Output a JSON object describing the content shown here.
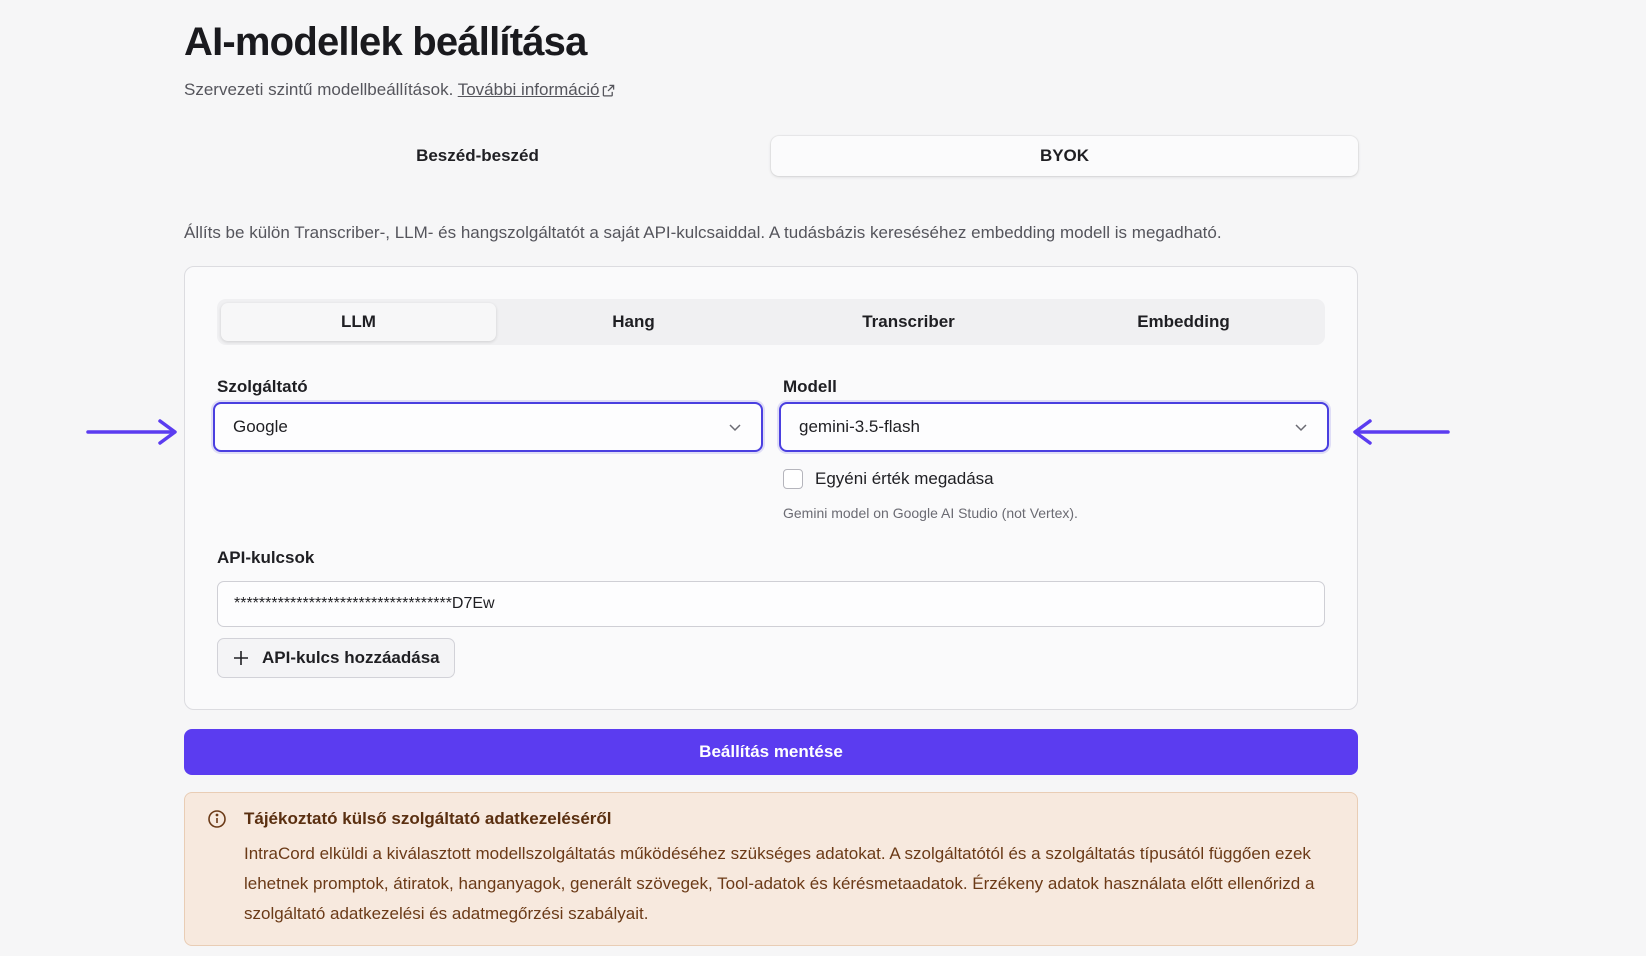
{
  "header": {
    "title": "AI-modellek beállítása",
    "subtitle": "Szervezeti szintű modellbeállítások.",
    "more_info_link": "További információ"
  },
  "top_tabs": [
    {
      "label": "Beszéd-beszéd",
      "active": false
    },
    {
      "label": "BYOK",
      "active": true
    }
  ],
  "description": "Állíts be külön Transcriber-, LLM- és hangszolgáltatót a saját API-kulcsaiddal. A tudásbázis kereséséhez embedding modell is megadható.",
  "sub_tabs": [
    {
      "label": "LLM",
      "active": true
    },
    {
      "label": "Hang",
      "active": false
    },
    {
      "label": "Transcriber",
      "active": false
    },
    {
      "label": "Embedding",
      "active": false
    }
  ],
  "provider": {
    "label": "Szolgáltató",
    "value": "Google"
  },
  "model": {
    "label": "Modell",
    "value": "gemini-3.5-flash",
    "custom_value_label": "Egyéni érték megadása",
    "custom_value_checked": false,
    "hint": "Gemini model on Google AI Studio (not Vertex)."
  },
  "api_keys": {
    "label": "API-kulcsok",
    "value": "***********************************D7Ew",
    "add_button_label": "API-kulcs hozzáadása"
  },
  "save_button_label": "Beállítás mentése",
  "notice": {
    "title": "Tájékoztató külső szolgáltató adatkezeléséről",
    "body": "IntraCord elküldi a kiválasztott modellszolgáltatás működéséhez szükséges adatokat. A szolgáltatótól és a szolgáltatás típusától függően ezek lehetnek promptok, átiratok, hanganyagok, generált szövegek, Tool-adatok és kérésmetaadatok. Érzékeny adatok használata előtt ellenőrizd a szolgáltató adatkezelési és adatmegőrzési szabályait."
  },
  "colors": {
    "accent": "#5b3cf0",
    "focus_border": "#4a3fe0",
    "notice_bg": "#f7e9de",
    "notice_text": "#6b3a17"
  },
  "icons": [
    "external-link-icon",
    "chevron-down-icon",
    "plus-icon",
    "info-icon",
    "arrow-right-icon",
    "arrow-left-icon"
  ]
}
